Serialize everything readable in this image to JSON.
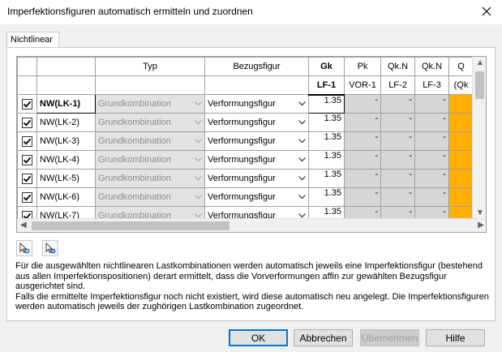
{
  "window": {
    "title": "Imperfektionsfiguren automatisch ermitteln und zuordnen"
  },
  "tab": {
    "label": "Nichtlinear"
  },
  "table": {
    "headers_row1": {
      "typ": "Typ",
      "bezugsfigur": "Bezugsfigur",
      "gk": "Gk",
      "pk": "Pk",
      "qkn1": "Qk.N",
      "qkn2": "Qk.N",
      "partial": "Q"
    },
    "headers_row2": {
      "gk": "LF-1",
      "pk": "VOR-1",
      "qkn1": "LF-2",
      "qkn2": "LF-3",
      "partial": "(Qk"
    },
    "rows": [
      {
        "name": "NW(LK-1)",
        "typ": "Grundkombination",
        "bezug": "Verformungsfigur",
        "gk": "1.35",
        "pk": "-",
        "qkn1": "-",
        "qkn2": "-"
      },
      {
        "name": "NW(LK-2)",
        "typ": "Grundkombination",
        "bezug": "Verformungsfigur",
        "gk": "1.35",
        "pk": "-",
        "qkn1": "-",
        "qkn2": "-"
      },
      {
        "name": "NW(LK-3)",
        "typ": "Grundkombination",
        "bezug": "Verformungsfigur",
        "gk": "1.35",
        "pk": "-",
        "qkn1": "-",
        "qkn2": "-"
      },
      {
        "name": "NW(LK-4)",
        "typ": "Grundkombination",
        "bezug": "Verformungsfigur",
        "gk": "1.35",
        "pk": "-",
        "qkn1": "-",
        "qkn2": "-"
      },
      {
        "name": "NW(LK-5)",
        "typ": "Grundkombination",
        "bezug": "Verformungsfigur",
        "gk": "1.35",
        "pk": "-",
        "qkn1": "-",
        "qkn2": "-"
      },
      {
        "name": "NW(LK-6)",
        "typ": "Grundkombination",
        "bezug": "Verformungsfigur",
        "gk": "1.35",
        "pk": "-",
        "qkn1": "-",
        "qkn2": "-"
      },
      {
        "name": "NW(LK-7)",
        "typ": "Grundkombination",
        "bezug": "Verformungsfigur",
        "gk": "1.35",
        "pk": "-",
        "qkn1": "-",
        "qkn2": "-"
      }
    ]
  },
  "info_text": {
    "line1": "Für die ausgewählten nichtlinearen Lastkombinationen werden automatisch jeweils eine Imperfektionsfigur (bestehend",
    "line2": "aus allen Imperfektionspositionen) derart ermittelt, dass die Vorverformungen affin zur gewählten Bezugsfigur",
    "line3": "ausgerichtet sind.",
    "line4": "Falls die ermittelte Imperfektionsfigur noch nicht existiert, wird diese automatisch neu angelegt. Die Imperfektionsfiguren",
    "line5": "werden automatisch jeweils der zughörigen Lastkombination zugeordnet."
  },
  "buttons": {
    "ok": "OK",
    "cancel": "Abbrechen",
    "apply": "Übernehmen",
    "help": "Hilfe"
  },
  "colors": {
    "highlight": "#ffb000",
    "dialog_bg": "#f0f0f0",
    "default_button_border": "#0078d7"
  }
}
